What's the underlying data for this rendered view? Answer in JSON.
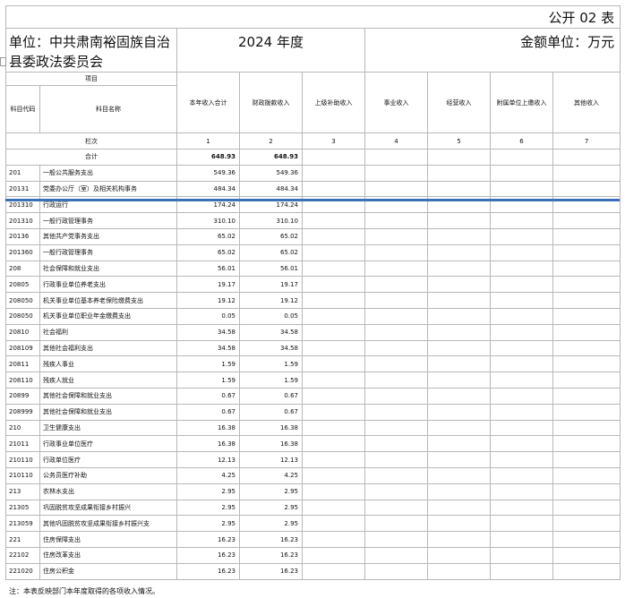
{
  "form_label": "公开 02 表",
  "unit_label": "单位：中共肃南裕固族自治县委政法委员会",
  "year_label": "2024 年度",
  "amount_unit": "金额单位：万元",
  "header": {
    "project": "项目",
    "subject_code": "科目代码",
    "subject_name": "科目名称",
    "columns": [
      "本年收入合计",
      "财政拨款收入",
      "上级补助收入",
      "事业收入",
      "经营收入",
      "附属单位上缴收入",
      "其他收入"
    ]
  },
  "seq_row": {
    "label": "栏次",
    "nums": [
      "1",
      "2",
      "3",
      "4",
      "5",
      "6",
      "7"
    ]
  },
  "total_row": {
    "label": "合计",
    "total": "648.93",
    "fiscal": "648.93"
  },
  "rows": [
    {
      "code": "201",
      "name": "一般公共服务支出",
      "total": "549.36",
      "fiscal": "549.36"
    },
    {
      "code": "20131",
      "name": "党委办公厅（室）及相关机构事务",
      "total": "484.34",
      "fiscal": "484.34"
    },
    {
      "code": "201310",
      "name": "行政运行",
      "total": "174.24",
      "fiscal": "174.24"
    },
    {
      "code": "201310",
      "name": "一般行政管理事务",
      "total": "310.10",
      "fiscal": "310.10"
    },
    {
      "code": "20136",
      "name": "其他共产党事务支出",
      "total": "65.02",
      "fiscal": "65.02"
    },
    {
      "code": "201360",
      "name": "一般行政管理事务",
      "total": "65.02",
      "fiscal": "65.02"
    },
    {
      "code": "208",
      "name": "社会保障和就业支出",
      "total": "56.01",
      "fiscal": "56.01"
    },
    {
      "code": "20805",
      "name": "行政事业单位养老支出",
      "total": "19.17",
      "fiscal": "19.17"
    },
    {
      "code": "208050",
      "name": "机关事业单位基本养老保险缴费支出",
      "total": "19.12",
      "fiscal": "19.12"
    },
    {
      "code": "208050",
      "name": "机关事业单位职业年金缴费支出",
      "total": "0.05",
      "fiscal": "0.05"
    },
    {
      "code": "20810",
      "name": "社会福利",
      "total": "34.58",
      "fiscal": "34.58"
    },
    {
      "code": "208109",
      "name": "其他社会福利支出",
      "total": "34.58",
      "fiscal": "34.58"
    },
    {
      "code": "20811",
      "name": "残疾人事业",
      "total": "1.59",
      "fiscal": "1.59"
    },
    {
      "code": "208110",
      "name": "残疾人就业",
      "total": "1.59",
      "fiscal": "1.59"
    },
    {
      "code": "20899",
      "name": "其他社会保障和就业支出",
      "total": "0.67",
      "fiscal": "0.67"
    },
    {
      "code": "208999",
      "name": "其他社会保障和就业支出",
      "total": "0.67",
      "fiscal": "0.67"
    },
    {
      "code": "210",
      "name": "卫生健康支出",
      "total": "16.38",
      "fiscal": "16.38"
    },
    {
      "code": "21011",
      "name": "行政事业单位医疗",
      "total": "16.38",
      "fiscal": "16.38"
    },
    {
      "code": "210110",
      "name": "行政单位医疗",
      "total": "12.13",
      "fiscal": "12.13"
    },
    {
      "code": "210110",
      "name": "公务员医疗补助",
      "total": "4.25",
      "fiscal": "4.25"
    },
    {
      "code": "213",
      "name": "农林水支出",
      "total": "2.95",
      "fiscal": "2.95"
    },
    {
      "code": "21305",
      "name": "巩固脱贫攻坚成果衔接乡村振兴",
      "total": "2.95",
      "fiscal": "2.95"
    },
    {
      "code": "213059",
      "name": "其他巩固脱贫攻坚成果衔接乡村振兴支",
      "total": "2.95",
      "fiscal": "2.95"
    },
    {
      "code": "221",
      "name": "住房保障支出",
      "total": "16.23",
      "fiscal": "16.23"
    },
    {
      "code": "22102",
      "name": "住房改革支出",
      "total": "16.23",
      "fiscal": "16.23"
    },
    {
      "code": "221020",
      "name": "住房公积金",
      "total": "16.23",
      "fiscal": "16.23"
    }
  ],
  "note": "注：本表反映部门本年度取得的各项收入情况。"
}
